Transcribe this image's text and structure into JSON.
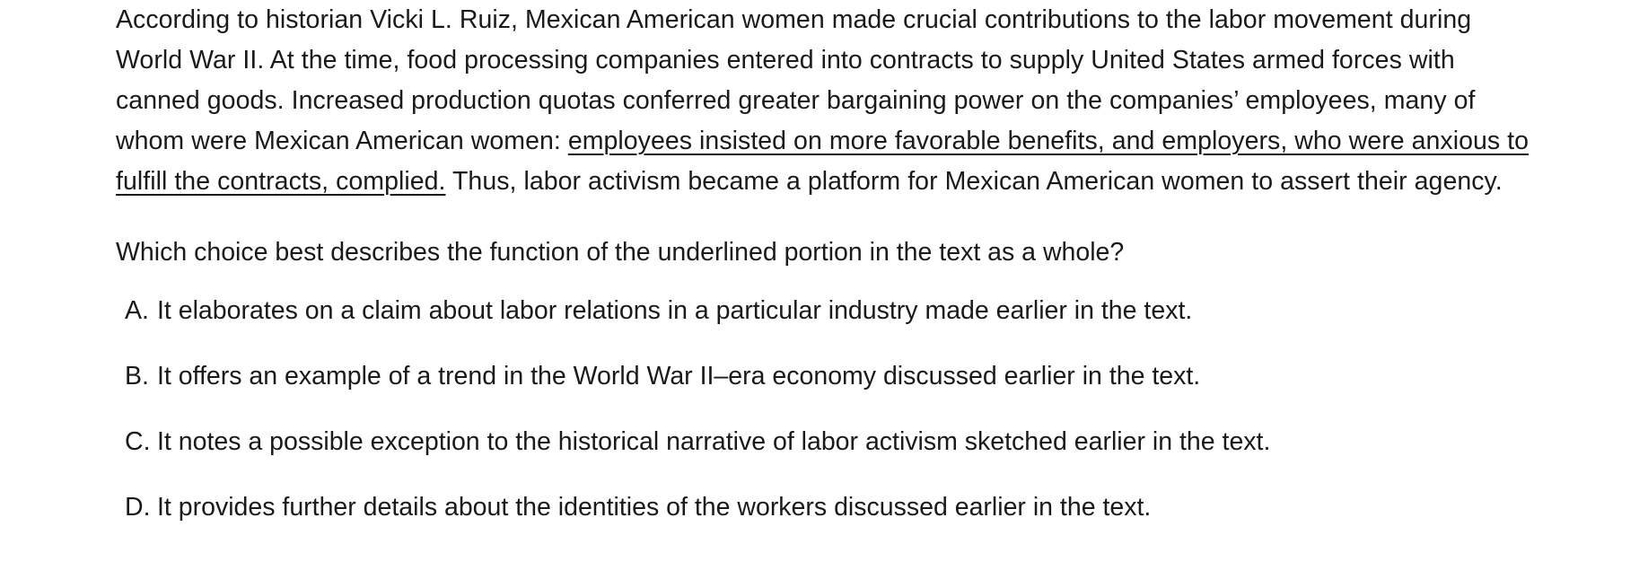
{
  "passage": {
    "before": "According to historian Vicki L. Ruiz, Mexican American women made crucial contributions to the labor movement during World War II. At the time, food processing companies entered into contracts to supply United States armed forces with canned goods. Increased production quotas conferred greater bargaining power on the companies’ employees, many of whom were Mexican American women: ",
    "underlined": "employees insisted on more favorable benefits, and employers, who were anxious to fulfill the contracts, complied.",
    "after": " Thus, labor activism became a platform for Mexican American women to assert their agency."
  },
  "question": "Which choice best describes the function of the underlined portion in the text as a whole?",
  "choices": [
    {
      "letter": "A.",
      "text": "It elaborates on a claim about labor relations in a particular industry made earlier in the text."
    },
    {
      "letter": "B.",
      "text": "It offers an example of a trend in the World War II–era economy discussed earlier in the text."
    },
    {
      "letter": "C.",
      "text": "It notes a possible exception to the historical narrative of labor activism sketched earlier in the text."
    },
    {
      "letter": "D.",
      "text": "It provides further details about the identities of the workers discussed earlier in the text."
    }
  ]
}
